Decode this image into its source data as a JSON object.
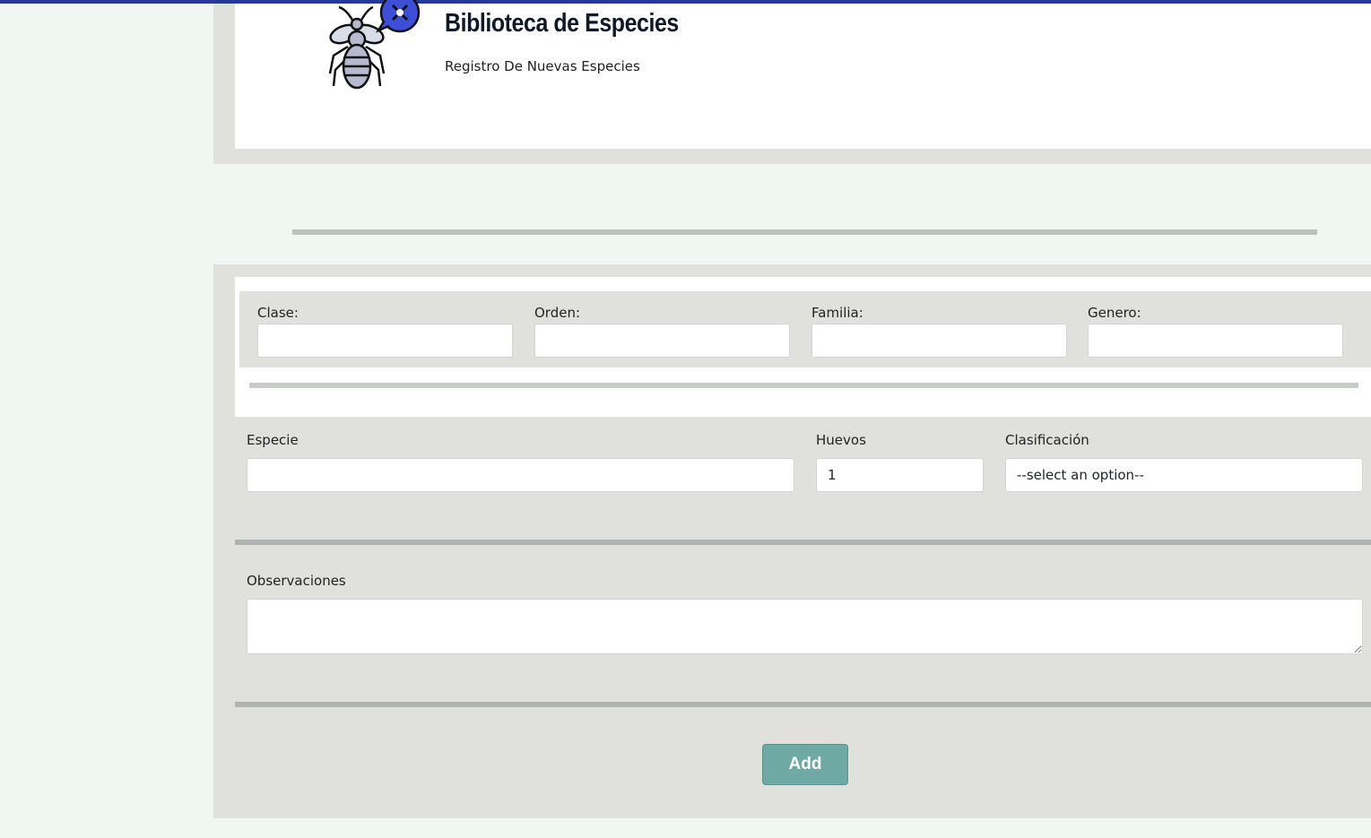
{
  "header": {
    "title": "Biblioteca de Especies",
    "subtitle": "Registro De Nuevas Especies",
    "logo_icon": "insect-logo-icon"
  },
  "taxonomy": {
    "clase_label": "Clase:",
    "clase_value": "",
    "orden_label": "Orden:",
    "orden_value": "",
    "familia_label": "Familia:",
    "familia_value": "",
    "genero_label": "Genero:",
    "genero_value": ""
  },
  "details": {
    "especie_label": "Especie",
    "especie_value": "",
    "huevos_label": "Huevos",
    "huevos_value": "1",
    "clasificacion_label": "Clasificación",
    "clasificacion_selected": "--select an option--"
  },
  "observaciones": {
    "label": "Observaciones",
    "value": ""
  },
  "actions": {
    "add_label": "Add"
  },
  "colors": {
    "top_bar": "#27389c",
    "page_bg": "#f0f6f2",
    "panel_bg": "#e0e1dd",
    "add_button": "#6fa9a4"
  }
}
